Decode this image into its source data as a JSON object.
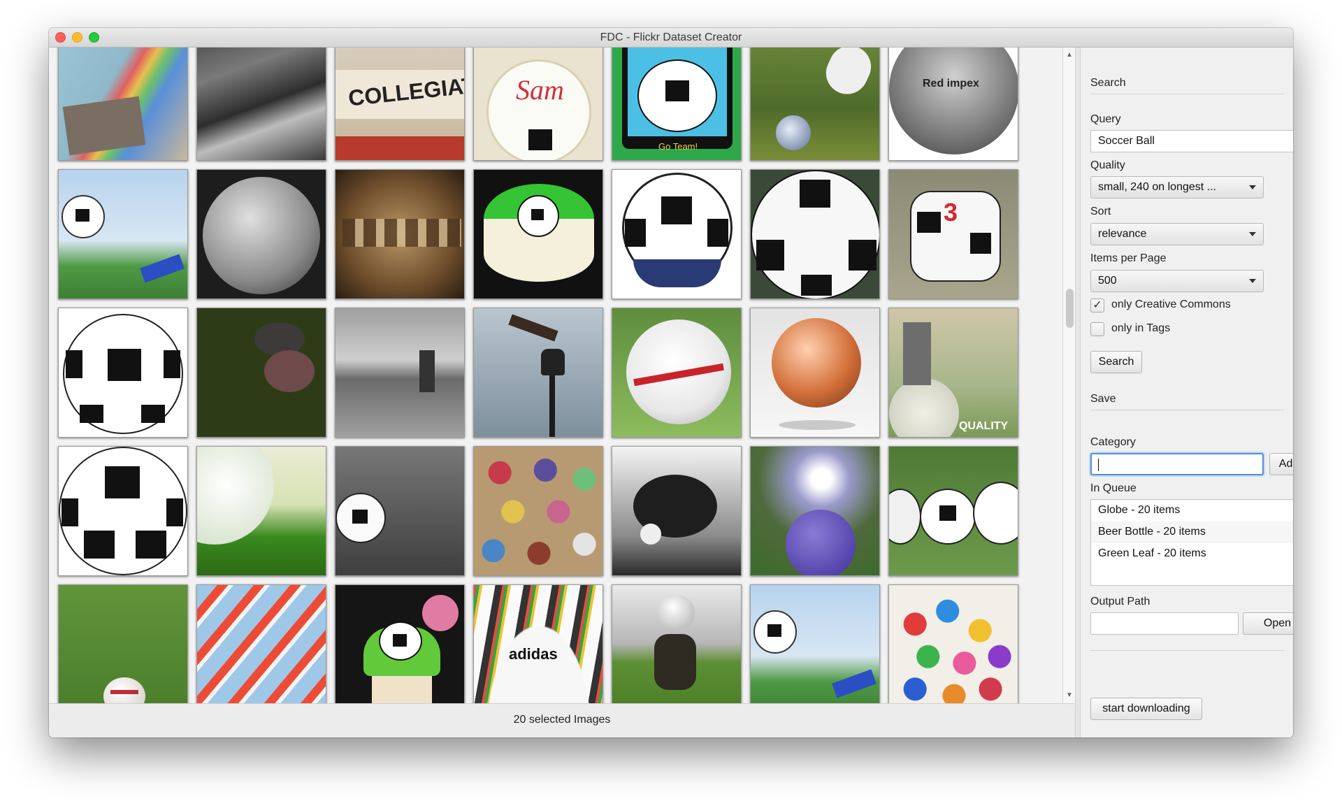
{
  "window": {
    "title": "FDC - Flickr Dataset Creator"
  },
  "status": {
    "selected_text": "20 selected Images"
  },
  "search_panel": {
    "section_title": "Search",
    "query_label": "Query",
    "query_value": "Soccer Ball",
    "quality_label": "Quality",
    "quality_value": "small, 240 on longest ...",
    "sort_label": "Sort",
    "sort_value": "relevance",
    "items_label": "Items per Page",
    "items_value": "500",
    "cc_label": "only Creative Commons",
    "cc_checked": "✓",
    "tags_label": "only in Tags",
    "search_button": "Search"
  },
  "save_panel": {
    "section_title": "Save",
    "category_label": "Category",
    "add_button": "Add",
    "queue_label": "In Queue",
    "queue": [
      "Globe - 20 items",
      "Beer Bottle - 20 items",
      "Green Leaf - 20 items"
    ],
    "output_label": "Output Path",
    "open_button": "Open",
    "download_button": "start downloading"
  },
  "thumbnails": {
    "tile_text": {
      "collegiate": "COLLEGIAT",
      "sam": "Sam",
      "go_team": "Go Team!",
      "red_impex": "Red impex",
      "quality": "QUALITY",
      "adidas": "adidas"
    }
  }
}
